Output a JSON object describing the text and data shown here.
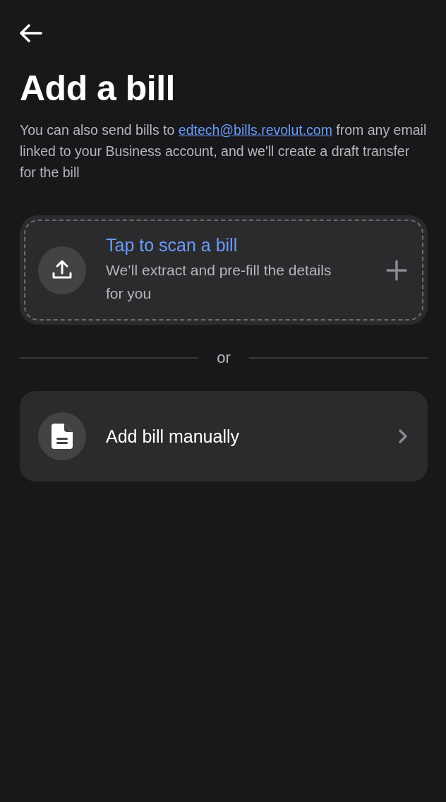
{
  "title": "Add a bill",
  "description": {
    "text_before": "You can also send bills to",
    "link": "edtech@bills.revolut.com",
    "text_after": "from any email linked to your Business account, and we'll create a draft transfer for the bill"
  },
  "options": [
    {
      "kind": "scan",
      "title": "Tap to scan a bill",
      "subtitle": "We’ll extract and pre-fill the details for you"
    },
    {
      "kind": "manual",
      "title": "Add bill manually"
    }
  ],
  "separator": "or"
}
